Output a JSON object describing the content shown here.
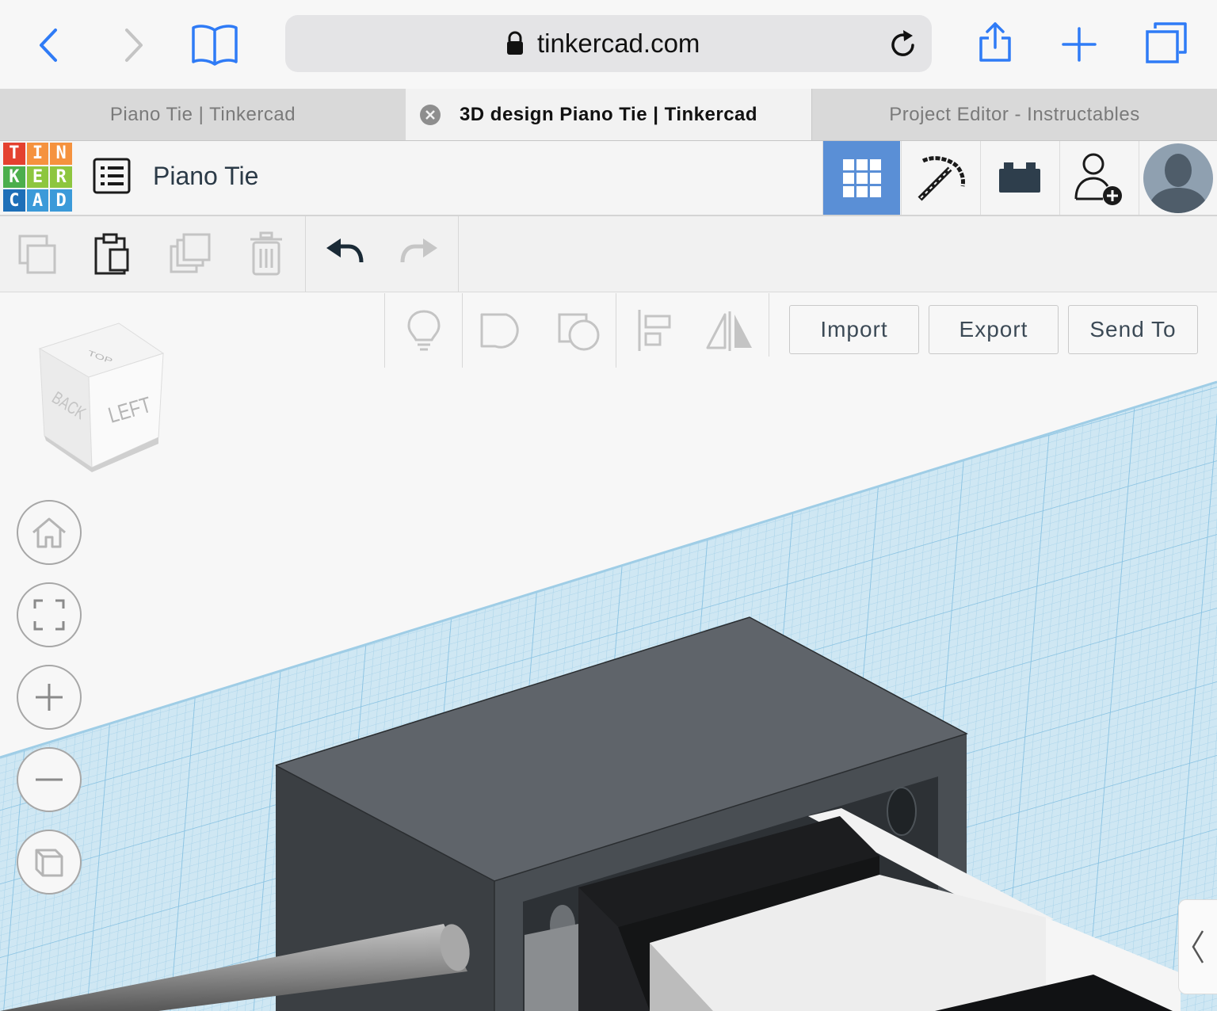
{
  "browser": {
    "url": "tinkercad.com",
    "icons": [
      "back-icon",
      "forward-icon",
      "bookmarks-icon",
      "lock-icon",
      "reload-icon",
      "share-icon",
      "new-tab-icon",
      "tabs-icon"
    ]
  },
  "tabs": [
    {
      "label": "Piano Tie | Tinkercad",
      "active": false
    },
    {
      "label": "3D design Piano Tie | Tinkercad",
      "active": true
    },
    {
      "label": "Project Editor - Instructables",
      "active": false
    }
  ],
  "app": {
    "logo_letters": [
      "T",
      "I",
      "N",
      "K",
      "E",
      "R",
      "C",
      "A",
      "D"
    ],
    "design_title": "Piano Tie",
    "accent_color": "#5a8fd6"
  },
  "toolbar": {
    "import_label": "Import",
    "export_label": "Export",
    "send_to_label": "Send To"
  },
  "viewcube": {
    "top": "TOP",
    "back": "BACK",
    "left": "LEFT"
  }
}
